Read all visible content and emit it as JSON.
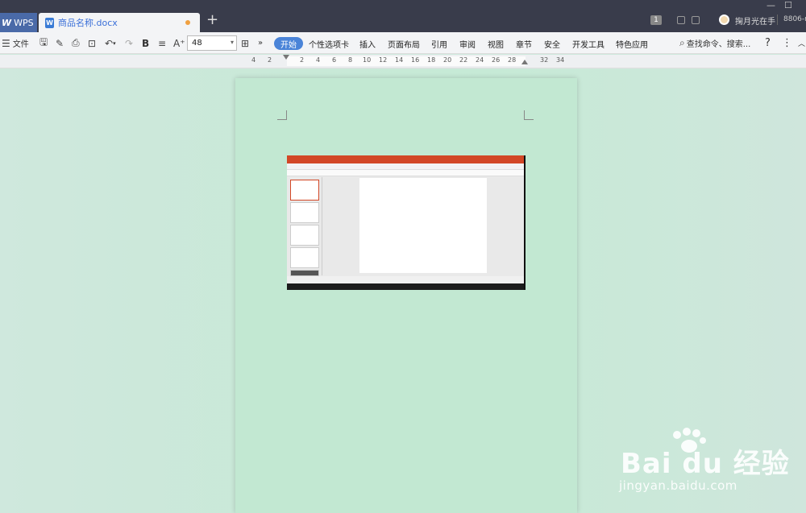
{
  "titlebar": {
    "wps_tab": "WPS",
    "doc_tab": "商品名称.docx",
    "doc_icon": "W",
    "new_tab": "+",
    "badge": "1",
    "user": "掬月光在手",
    "account": "8806-r",
    "minimize": "—",
    "maximize": "☐"
  },
  "toolbar": {
    "menu_label": "文件",
    "font_size": "48",
    "more": "»",
    "active_tab": "开始",
    "tabs": [
      "个性选项卡",
      "插入",
      "页面布局",
      "引用",
      "审阅",
      "视图",
      "章节",
      "安全",
      "开发工具",
      "特色应用"
    ],
    "search": "查找命令、搜索...",
    "help": "?",
    "more_menu": "⋮"
  },
  "ruler": {
    "ticks": [
      "4",
      "2",
      "2",
      "4",
      "6",
      "8",
      "10",
      "12",
      "14",
      "16",
      "18",
      "20",
      "22",
      "24",
      "26",
      "28",
      "32",
      "34"
    ]
  },
  "watermark": {
    "brand": "Bai du 经验",
    "url": "jingyan.baidu.com"
  },
  "colors": {
    "titlebar": "#393c4b",
    "accent": "#4a84d8",
    "page": "#c2e8d2",
    "ppt_accent": "#d24726"
  }
}
